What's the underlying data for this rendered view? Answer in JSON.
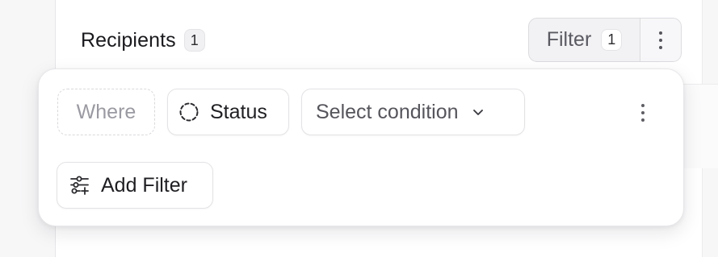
{
  "header": {
    "title": "Recipients",
    "count": "1"
  },
  "toolbar": {
    "filter_label": "Filter",
    "filter_count": "1",
    "more_icon": "more-vertical-icon"
  },
  "filter_popover": {
    "where_label": "Where",
    "field": {
      "label": "Status",
      "icon": "status-dashed-circle-icon"
    },
    "condition": {
      "placeholder": "Select condition",
      "icon": "chevron-down-icon"
    },
    "row_more_icon": "more-vertical-icon",
    "add_filter": {
      "label": "Add Filter",
      "icon": "sliders-add-icon"
    }
  },
  "colors": {
    "text_primary": "#1f1f23",
    "text_muted": "#9a9aa2",
    "border": "#e3e3e6",
    "page_background": "#f7f7f8"
  }
}
